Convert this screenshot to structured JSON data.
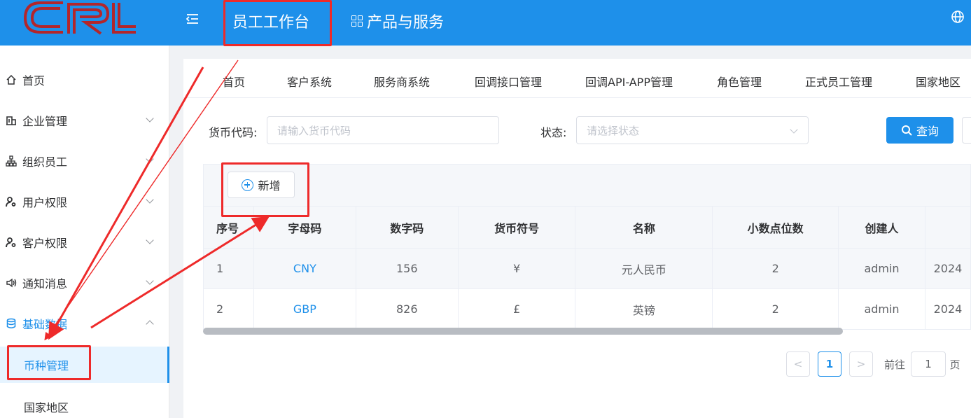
{
  "header": {
    "workbench_label": "员工工作台",
    "products_label": "产品与服务",
    "logo_text": "CRL",
    "brand_color": "#1e90ea",
    "icons": [
      "menu-toggle-icon",
      "grid-icon",
      "globe-icon"
    ]
  },
  "sidebar": {
    "items": [
      {
        "label": "首页",
        "icon": "home-icon"
      },
      {
        "label": "企业管理",
        "icon": "building-icon"
      },
      {
        "label": "组织员工",
        "icon": "org-chart-icon"
      },
      {
        "label": "用户权限",
        "icon": "user-key-icon"
      },
      {
        "label": "客户权限",
        "icon": "user-key-icon"
      },
      {
        "label": "通知消息",
        "icon": "speaker-icon"
      },
      {
        "label": "基础数据",
        "icon": "database-icon",
        "expanded": true
      }
    ],
    "subitems": [
      {
        "label": "币种管理",
        "active": true
      },
      {
        "label": "国家地区"
      }
    ]
  },
  "tabs": [
    "首页",
    "客户系统",
    "服务商系统",
    "回调接口管理",
    "回调API-APP管理",
    "角色管理",
    "正式员工管理",
    "国家地区"
  ],
  "search": {
    "currency_code_label": "货币代码:",
    "currency_code_placeholder": "请输入货币代码",
    "status_label": "状态:",
    "status_placeholder": "请选择状态",
    "query_label": "查询"
  },
  "toolbar": {
    "add_label": "新增"
  },
  "table": {
    "headers": [
      "序号",
      "字母码",
      "数字码",
      "货币符号",
      "名称",
      "小数点位数",
      "创建人",
      ""
    ],
    "rows": [
      [
        "1",
        "CNY",
        "156",
        "¥",
        "元人民币",
        "2",
        "admin",
        "2024"
      ],
      [
        "2",
        "GBP",
        "826",
        "£",
        "英镑",
        "2",
        "admin",
        "2024"
      ]
    ]
  },
  "pagination": {
    "prev": "<",
    "current": "1",
    "next": ">",
    "goto_label": "前往",
    "goto_value": "1",
    "page_suffix": "页"
  },
  "annotation_color": "#ee2a2a"
}
